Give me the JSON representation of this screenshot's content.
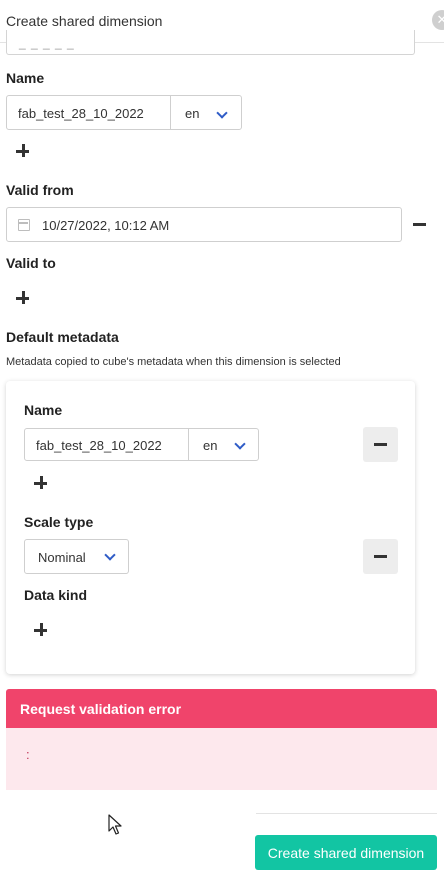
{
  "header": {
    "title": "Create shared dimension",
    "close_icon": "close-icon"
  },
  "form": {
    "partial_field_value": "_ _ _ _ _",
    "name_label": "Name",
    "name_value": "fab_test_28_10_2022",
    "name_lang": "en",
    "valid_from_label": "Valid from",
    "valid_from_value": "10/27/2022, 10:12 AM",
    "valid_to_label": "Valid to",
    "default_metadata_label": "Default metadata",
    "default_metadata_desc": "Metadata copied to cube's metadata when this dimension is selected"
  },
  "metadata_card": {
    "name_label": "Name",
    "name_value": "fab_test_28_10_2022",
    "name_lang": "en",
    "scale_type_label": "Scale type",
    "scale_type_value": "Nominal",
    "data_kind_label": "Data kind"
  },
  "error": {
    "title": "Request validation error",
    "message": ":"
  },
  "footer": {
    "submit_label": "Create shared dimension"
  },
  "colors": {
    "accent": "#12c5a3",
    "error": "#f0446b",
    "error_bg": "#fde8ed",
    "chevron": "#2f5cc7"
  }
}
